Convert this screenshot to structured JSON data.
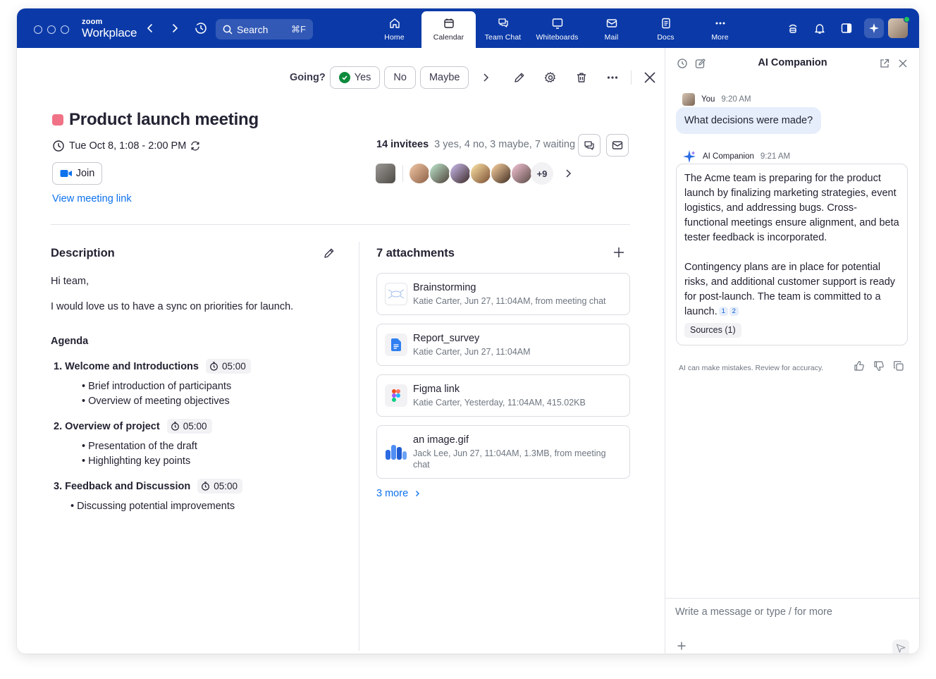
{
  "app": {
    "brand_small": "zoom",
    "brand_big": "Workplace",
    "search_label": "Search",
    "search_shortcut": "⌘F",
    "accent": "#0b3aa8",
    "link_color": "#0e72ed"
  },
  "nav": {
    "tabs": [
      {
        "label": "Home",
        "icon": "home-icon"
      },
      {
        "label": "Calendar",
        "icon": "calendar-icon",
        "active": true
      },
      {
        "label": "Team Chat",
        "icon": "chat-icon"
      },
      {
        "label": "Whiteboards",
        "icon": "whiteboard-icon"
      },
      {
        "label": "Mail",
        "icon": "mail-icon"
      },
      {
        "label": "Docs",
        "icon": "docs-icon"
      },
      {
        "label": "More",
        "icon": "more-icon"
      }
    ]
  },
  "event": {
    "going_label": "Going?",
    "rsvp": {
      "yes": "Yes",
      "no": "No",
      "maybe": "Maybe"
    },
    "title": "Product launch meeting",
    "title_color": "#f07286",
    "datetime": "Tue Oct 8, 1:08 - 2:00 PM",
    "join_label": "Join",
    "meeting_link_label": "View meeting link",
    "invitees_count": "14 invitees",
    "invitees_status": "3 yes, 4 no, 3 maybe, 7 waiting",
    "more_invitees": "+9"
  },
  "description": {
    "heading": "Description",
    "greeting": "Hi team,",
    "body": "I would love us to have a sync on priorities for launch.",
    "agenda_heading": "Agenda",
    "agenda": [
      {
        "title": "1. Welcome and Introductions",
        "duration": "05:00",
        "bullets": [
          "• Brief introduction of participants",
          "• Overview of meeting objectives"
        ]
      },
      {
        "title": "2. Overview of project",
        "duration": "05:00",
        "bullets": [
          "• Presentation of the draft",
          "• Highlighting key points"
        ]
      },
      {
        "title": "3. Feedback and Discussion",
        "duration": "05:00",
        "bullets": [
          "• Discussing potential improvements"
        ]
      }
    ]
  },
  "attachments": {
    "heading": "7 attachments",
    "items": [
      {
        "name": "Brainstorming",
        "meta": "Katie Carter, Jun 27, 11:04AM, from meeting chat",
        "icon": "whiteboard-file-icon"
      },
      {
        "name": "Report_survey",
        "meta": "Katie Carter, Jun 27, 11:04AM",
        "icon": "google-doc-icon"
      },
      {
        "name": "Figma link",
        "meta": "Katie Carter, Yesterday, 11:04AM, 415.02KB",
        "icon": "figma-icon"
      },
      {
        "name": "an image.gif",
        "meta": "Jack Lee, Jun 27, 11:04AM, 1.3MB, from meeting chat",
        "icon": "image-file-icon"
      }
    ],
    "more_label": "3 more"
  },
  "ai": {
    "title": "AI Companion",
    "user_name": "You",
    "user_time": "9:20 AM",
    "question": "What decisions were made?",
    "bot_name": "AI Companion",
    "bot_time": "9:21 AM",
    "answer_p1": "The Acme team is preparing for the product launch by finalizing marketing strategies, event logistics, and addressing bugs. Cross-functional meetings ensure alignment, and beta tester feedback is incorporated.",
    "answer_p2": "Contingency plans are in place for potential risks, and additional customer support is ready for post-launch. The team is committed to a launch.",
    "cite1": "1",
    "cite2": "2",
    "sources_label": "Sources (1)",
    "disclaimer": "AI can make mistakes. Review for accuracy.",
    "compose_placeholder": "Write a message or type / for more"
  }
}
